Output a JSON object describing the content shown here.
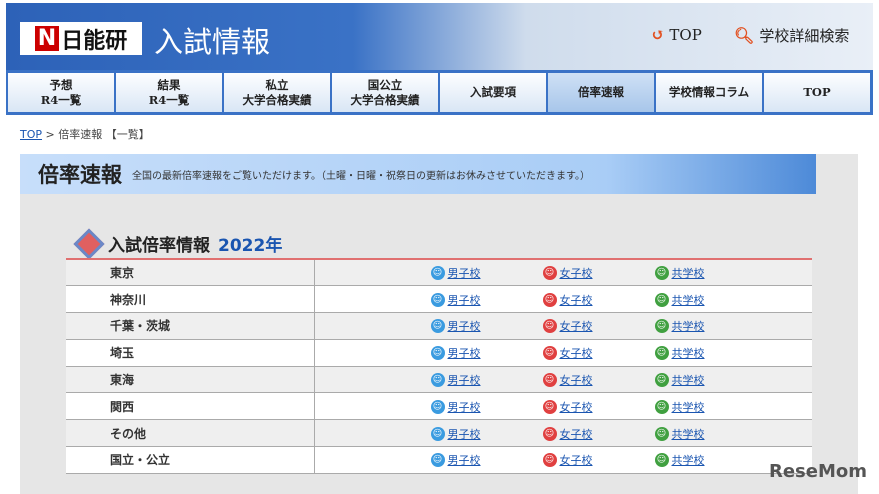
{
  "header": {
    "logo": "日能研",
    "title": "入試情報",
    "top_link": "TOP",
    "search_link": "学校詳細検索"
  },
  "nav": [
    {
      "l1": "予想",
      "l2": "R4一覧"
    },
    {
      "l1": "結果",
      "l2": "R4一覧"
    },
    {
      "l1": "私立",
      "l2": "大学合格実績"
    },
    {
      "l1": "国公立",
      "l2": "大学合格実績"
    },
    {
      "l1": "入試要項",
      "l2": ""
    },
    {
      "l1": "倍率速報",
      "l2": ""
    },
    {
      "l1": "学校情報コラム",
      "l2": ""
    },
    {
      "l1": "TOP",
      "l2": ""
    }
  ],
  "breadcrumb": {
    "top": "TOP",
    "sep": ">",
    "current": "倍率速報 【一覧】"
  },
  "band": {
    "title": "倍率速報",
    "desc": "全国の最新倍率速報をご覧いただけます。（土曜・日曜・祝祭日の更新はお休みさせていただきます。）"
  },
  "section": {
    "title": "入試倍率情報",
    "year": "2022年"
  },
  "links": {
    "boys": "男子校",
    "girls": "女子校",
    "coed": "共学校"
  },
  "colors": {
    "boys": "#3a9be0",
    "girls": "#e04040",
    "coed": "#40a040"
  },
  "regions": [
    "東京",
    "神奈川",
    "千葉・茨城",
    "埼玉",
    "東海",
    "関西",
    "その他",
    "国立・公立"
  ],
  "watermark": "ReseMom"
}
